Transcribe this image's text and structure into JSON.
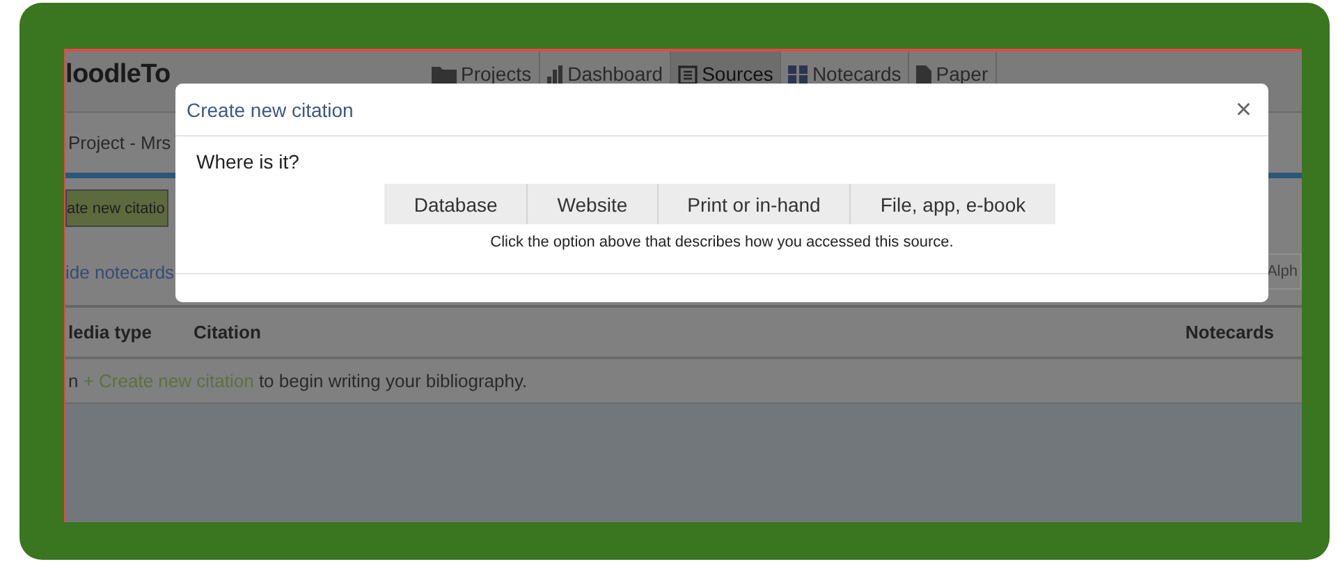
{
  "app": {
    "logo": "loodleTo",
    "nav_tabs": [
      {
        "label": "Projects",
        "selected": false
      },
      {
        "label": "Dashboard",
        "selected": false
      },
      {
        "label": "Sources",
        "selected": true
      },
      {
        "label": "Notecards",
        "selected": false
      },
      {
        "label": "Paper",
        "selected": false
      }
    ],
    "project_title": "Project - Mrs",
    "new_citation_button": "ate new citatio",
    "hide_notecards_link": "ide notecards",
    "sort_dropdown": "Alph",
    "table": {
      "columns": [
        "ledia type",
        "Citation",
        "Notecards"
      ],
      "empty_message": {
        "before": "n",
        "link": "+ Create new citation",
        "after": "to begin writing your bibliography."
      }
    }
  },
  "modal": {
    "title": "Create new citation",
    "close": "×",
    "question": "Where is it?",
    "options": [
      {
        "label": "Database",
        "selected": false
      },
      {
        "label": "Website",
        "selected": false
      },
      {
        "label": "Print or in-hand",
        "selected": false
      },
      {
        "label": "File, app, e-book",
        "selected": false
      }
    ],
    "hint": "Click the option above that describes how you accessed this source."
  }
}
